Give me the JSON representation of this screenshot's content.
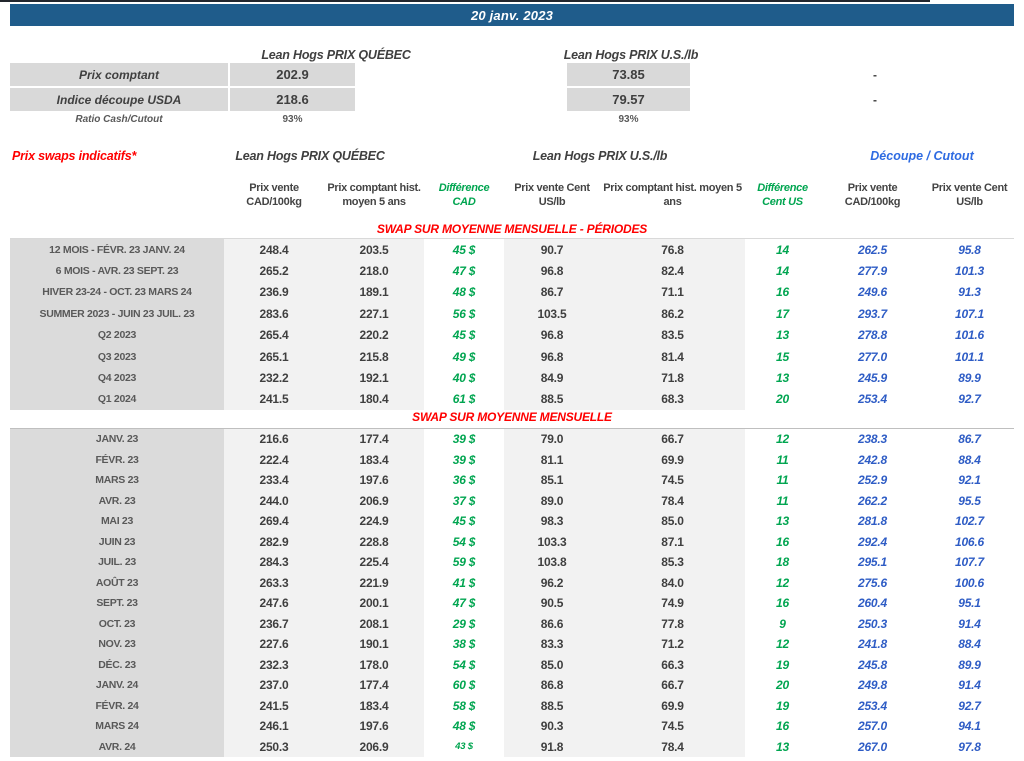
{
  "title_bar": {
    "date": "20 janv. 2023"
  },
  "colors": {
    "title_bar_blue": "#1f5c8b",
    "red_accent": "#ff0000",
    "green_difference": "#00a550",
    "blue_decoupe_values": "#2e5cc5",
    "blue_decoupe_header": "#2e6be2",
    "gray_label_band": "#dbdbdb",
    "gray_value_band": "#f2f2f2"
  },
  "summary": {
    "qc_header": "Lean Hogs PRIX QUÉBEC",
    "us_header": "Lean Hogs PRIX U.S./lb",
    "rows": [
      {
        "label": "Prix comptant",
        "qc": "202.9",
        "us": "73.85",
        "decoupe": "-"
      },
      {
        "label": "Indice découpe USDA",
        "qc": "218.6",
        "us": "79.57",
        "decoupe": "-"
      },
      {
        "label": "Ratio Cash/Cutout",
        "qc": "93%",
        "us": "93%",
        "decoupe": ""
      }
    ]
  },
  "swaps": {
    "title": "Prix swaps indicatifs*",
    "qc_header": "Lean Hogs PRIX QUÉBEC",
    "us_header": "Lean Hogs PRIX U.S./lb",
    "decoupe_header": "Découpe / Cutout",
    "columns": [
      "Prix vente CAD/100kg",
      "Prix comptant hist. moyen 5 ans",
      "Différence CAD",
      "Prix vente Cent US/lb",
      "Prix comptant hist. moyen 5 ans",
      "Différence Cent US",
      "Prix vente CAD/100kg",
      "Prix vente Cent US/lb"
    ],
    "sections": [
      {
        "title": "SWAP SUR MOYENNE MENSUELLE - PÉRIODES",
        "rows": [
          {
            "label": "12 MOIS - FÉVR. 23 JANV. 24",
            "cells": [
              "248.4",
              "203.5",
              "45 $",
              "90.7",
              "76.8",
              "14",
              "262.5",
              "95.8"
            ]
          },
          {
            "label": "6 MOIS - AVR. 23 SEPT. 23",
            "cells": [
              "265.2",
              "218.0",
              "47 $",
              "96.8",
              "82.4",
              "14",
              "277.9",
              "101.3"
            ]
          },
          {
            "label": "HIVER 23-24 -  OCT. 23 MARS 24",
            "cells": [
              "236.9",
              "189.1",
              "48 $",
              "86.7",
              "71.1",
              "16",
              "249.6",
              "91.3"
            ]
          },
          {
            "label": "SUMMER 2023 - JUIN 23 JUIL. 23",
            "cells": [
              "283.6",
              "227.1",
              "56 $",
              "103.5",
              "86.2",
              "17",
              "293.7",
              "107.1"
            ]
          },
          {
            "label": "Q2 2023",
            "cells": [
              "265.4",
              "220.2",
              "45 $",
              "96.8",
              "83.5",
              "13",
              "278.8",
              "101.6"
            ]
          },
          {
            "label": "Q3 2023",
            "cells": [
              "265.1",
              "215.8",
              "49 $",
              "96.8",
              "81.4",
              "15",
              "277.0",
              "101.1"
            ]
          },
          {
            "label": "Q4 2023",
            "cells": [
              "232.2",
              "192.1",
              "40 $",
              "84.9",
              "71.8",
              "13",
              "245.9",
              "89.9"
            ]
          },
          {
            "label": "Q1 2024",
            "cells": [
              "241.5",
              "180.4",
              "61 $",
              "88.5",
              "68.3",
              "20",
              "253.4",
              "92.7"
            ]
          }
        ]
      },
      {
        "title": "SWAP SUR MOYENNE MENSUELLE",
        "rows": [
          {
            "label": "JANV. 23",
            "cells": [
              "216.6",
              "177.4",
              "39 $",
              "79.0",
              "66.7",
              "12",
              "238.3",
              "86.7"
            ]
          },
          {
            "label": "FÉVR. 23",
            "cells": [
              "222.4",
              "183.4",
              "39 $",
              "81.1",
              "69.9",
              "11",
              "242.8",
              "88.4"
            ]
          },
          {
            "label": "MARS 23",
            "cells": [
              "233.4",
              "197.6",
              "36 $",
              "85.1",
              "74.5",
              "11",
              "252.9",
              "92.1"
            ]
          },
          {
            "label": "AVR. 23",
            "cells": [
              "244.0",
              "206.9",
              "37 $",
              "89.0",
              "78.4",
              "11",
              "262.2",
              "95.5"
            ]
          },
          {
            "label": "MAI 23",
            "cells": [
              "269.4",
              "224.9",
              "45 $",
              "98.3",
              "85.0",
              "13",
              "281.8",
              "102.7"
            ]
          },
          {
            "label": "JUIN 23",
            "cells": [
              "282.9",
              "228.8",
              "54 $",
              "103.3",
              "87.1",
              "16",
              "292.4",
              "106.6"
            ]
          },
          {
            "label": "JUIL. 23",
            "cells": [
              "284.3",
              "225.4",
              "59 $",
              "103.8",
              "85.3",
              "18",
              "295.1",
              "107.7"
            ]
          },
          {
            "label": "AOÛT 23",
            "cells": [
              "263.3",
              "221.9",
              "41 $",
              "96.2",
              "84.0",
              "12",
              "275.6",
              "100.6"
            ]
          },
          {
            "label": "SEPT. 23",
            "cells": [
              "247.6",
              "200.1",
              "47 $",
              "90.5",
              "74.9",
              "16",
              "260.4",
              "95.1"
            ]
          },
          {
            "label": "OCT. 23",
            "cells": [
              "236.7",
              "208.1",
              "29 $",
              "86.6",
              "77.8",
              "9",
              "250.3",
              "91.4"
            ]
          },
          {
            "label": "NOV. 23",
            "cells": [
              "227.6",
              "190.1",
              "38 $",
              "83.3",
              "71.2",
              "12",
              "241.8",
              "88.4"
            ]
          },
          {
            "label": "DÉC. 23",
            "cells": [
              "232.3",
              "178.0",
              "54 $",
              "85.0",
              "66.3",
              "19",
              "245.8",
              "89.9"
            ]
          },
          {
            "label": "JANV. 24",
            "cells": [
              "237.0",
              "177.4",
              "60 $",
              "86.8",
              "66.7",
              "20",
              "249.8",
              "91.4"
            ]
          },
          {
            "label": "FÉVR. 24",
            "cells": [
              "241.5",
              "183.4",
              "58 $",
              "88.5",
              "69.9",
              "19",
              "253.4",
              "92.7"
            ]
          },
          {
            "label": "MARS 24",
            "cells": [
              "246.1",
              "197.6",
              "48 $",
              "90.3",
              "74.5",
              "16",
              "257.0",
              "94.1"
            ]
          },
          {
            "label": "AVR. 24",
            "cells": [
              "250.3",
              "206.9",
              "43 $",
              "91.8",
              "78.4",
              "13",
              "267.0",
              "97.8"
            ],
            "small_diff": true
          }
        ]
      }
    ]
  }
}
